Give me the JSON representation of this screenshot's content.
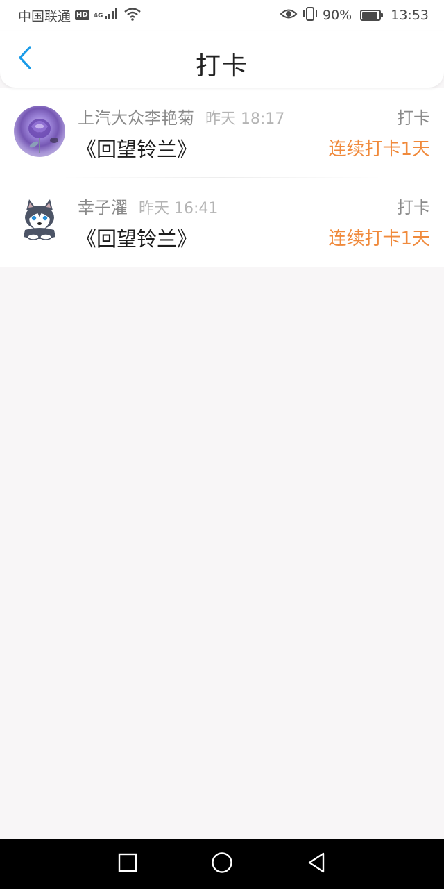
{
  "status_bar": {
    "carrier": "中国联通",
    "hd_badge": "HD",
    "network_type": "4G",
    "battery_percent": "90%",
    "battery_level": 0.9,
    "time": "13:53",
    "icons": [
      "signal-icon",
      "wifi-icon",
      "eye-icon",
      "vibrate-icon",
      "battery-icon"
    ]
  },
  "header": {
    "title": "打卡",
    "back_icon": "chevron-left-icon",
    "accent_color": "#1a9be8"
  },
  "checkins": [
    {
      "user": "上汽大众李艳菊",
      "time": "昨天 18:17",
      "type": "打卡",
      "book": "《回望铃兰》",
      "streak": "连续打卡1天",
      "avatar": "rose-avatar"
    },
    {
      "user": "幸子濯",
      "time": "昨天 16:41",
      "type": "打卡",
      "book": "《回望铃兰》",
      "streak": "连续打卡1天",
      "avatar": "husky-avatar"
    }
  ],
  "colors": {
    "streak": "#f08a3c",
    "background": "#f8f6f7"
  },
  "system_nav": {
    "icons": [
      "recent-apps-icon",
      "home-icon",
      "back-triangle-icon"
    ]
  }
}
